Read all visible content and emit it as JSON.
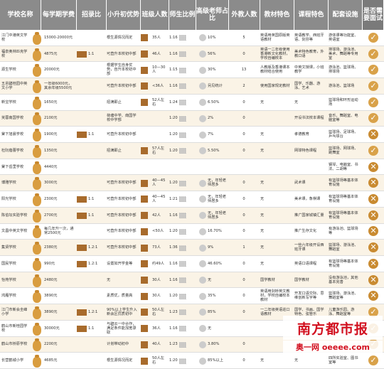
{
  "headers": [
    "学校名称",
    "每学期学费",
    "招录比",
    "小升初优势",
    "班级人数",
    "师生比例",
    "高级老师占比",
    "外教人数",
    "教材特色",
    "课程特色",
    "配套设施",
    "是否需要面试"
  ],
  "rows": [
    {
      "name": "江门中港英文学校",
      "fee": "15000-20000元",
      "ratio": "",
      "trans": "根生源情况而定",
      "class": "35人",
      "tr": "1:16",
      "senior": "10%",
      "foreign": "5",
      "books": "英语用英国原版英语教材",
      "course": "英语教学、西班牙语、剑芬等",
      "fac": "游体课等功能室、英语室",
      "intv": "yes"
    },
    {
      "name": "福泉奥林匹克学校",
      "fee": "4875元",
      "ratio": "1:1",
      "trans": "可直升本校初中部",
      "class": "46人",
      "tr": "1:16",
      "senior": "56%",
      "foreign": "0",
      "books": "英语一二年级使用香港新文化教材，学校自编校本",
      "course": "美术特色教育，外教口语",
      "fac": "排球场、游泳池、美术、舞蹈等专用室",
      "intv": "yes"
    },
    {
      "name": "源生学校",
      "fee": "20000元",
      "ratio": "",
      "trans": "根据学生自身优势，自升本校初中部",
      "class": "10—30人",
      "tr": "1:15",
      "senior": "30%",
      "foreign": "13",
      "books": "人教版及香港课本教材结合使用",
      "course": "中英文授课，小班教学",
      "fac": "游泳池、篮球场、排球场",
      "intv": "yes"
    },
    {
      "name": "五邑碧桂园中英文小学",
      "fee": "一年级6000元，其余年级5500元",
      "ratio": "",
      "trans": "可直升本校初中部",
      "class": "<36人",
      "tr": "1:16",
      "senior": "另见统计",
      "foreign": "2",
      "books": "使用国家规定教材",
      "course": "国学、乐器、游泳、艺术",
      "fac": "游泳池、篮球场",
      "intv": "yes"
    },
    {
      "name": "新宝学校",
      "fee": "1650元",
      "ratio": "",
      "trans": "招满即止",
      "class": "52人左右",
      "tr": "1:24",
      "senior": "6.50%",
      "foreign": "0",
      "books": "无",
      "course": "无",
      "fac": "篮球场和环形运动场",
      "intv": "yes"
    },
    {
      "name": "芙蓉南国学校",
      "fee": "2100元",
      "ratio": "",
      "trans": "荷塘中学、南国学校中学部",
      "class": "",
      "tr": "1:20",
      "senior": "2%",
      "foreign": "0",
      "books": "",
      "course": "开设书法校本课程",
      "fac": "音乐、舞蹈室、电脑室等",
      "intv": "yes"
    },
    {
      "name": "棠下旭晨学校",
      "fee": "1900元",
      "ratio": "1:1",
      "trans": "可直升本校初中部",
      "class": "",
      "tr": "1:20",
      "senior": "7%",
      "foreign": "0",
      "books": "无",
      "course": "孝德教育",
      "fac": "篮球场、足球场、乒乓球台",
      "intv": "no"
    },
    {
      "name": "杜阮蓓蕾学校",
      "fee": "1350元",
      "ratio": "",
      "trans": "招满即止",
      "class": "57人左右",
      "tr": "1:20",
      "senior": "5.50%",
      "foreign": "0",
      "books": "无",
      "course": "网球特色课程",
      "fac": "篮球场、网球场、跳舞室",
      "intv": "yes"
    },
    {
      "name": "棠下岳里学校",
      "fee": "4440元",
      "ratio": "",
      "trans": "",
      "class": "",
      "tr": "",
      "senior": "",
      "foreign": "",
      "books": "",
      "course": "",
      "fac": "钢琴、电脑室、书法、二胡等",
      "intv": "no"
    },
    {
      "name": "博雅学校",
      "fee": "3000元",
      "ratio": "",
      "trans": "可直升本校初中部",
      "class": "40—45人",
      "tr": "1:20",
      "senior": "无，年轻老师居多",
      "foreign": "0",
      "books": "无",
      "course": "武术课",
      "fac": "有篮球场等基本体育设施",
      "intv": "no"
    },
    {
      "name": "阳光学校",
      "fee": "2300元",
      "ratio": "1:1",
      "trans": "可直升本校初中部",
      "class": "40—45人",
      "tr": "1:21",
      "senior": "无，年轻老师居多",
      "foreign": "0",
      "books": "无",
      "course": "美术课，象棋课",
      "fac": "有篮球场等基本体育设施",
      "intv": "no"
    },
    {
      "name": "陈伯坛实验学校",
      "fee": "2700元",
      "ratio": "1:1",
      "trans": "可直升本校初中部",
      "class": "42人",
      "tr": "1:16",
      "senior": "无，年轻老师居多",
      "foreign": "0",
      "books": "无",
      "course": "推广国家城镇汇量",
      "fac": "有篮球场等基本体育设施",
      "intv": "no"
    },
    {
      "name": "文昌中英文学校",
      "fee": "每几年升一次，通常2500元",
      "ratio": "",
      "trans": "可直升本校初中部",
      "class": "<50人",
      "tr": "1:20",
      "senior": "16.70%",
      "foreign": "0",
      "books": "无",
      "course": "推广生存文化",
      "fac": "有游泳池、篮球场等",
      "intv": "no"
    },
    {
      "name": "集贤学校",
      "fee": "2380元",
      "ratio": "1.2:1",
      "trans": "可直升本校初中部",
      "class": "73人",
      "tr": "1:36",
      "senior": "9%",
      "foreign": "1",
      "books": "无",
      "course": "一些六年级开设西班牙课",
      "fac": "篮球场、游泳池、舞蹈室",
      "intv": "no"
    },
    {
      "name": "国民学校",
      "fee": "990元",
      "ratio": "1.2:1",
      "trans": "设置如开学金等",
      "class": "约49人",
      "tr": "1:16",
      "senior": "46.60%",
      "foreign": "0",
      "books": "无",
      "course": "英语口语课程",
      "fac": "有篮球场等基本体育设施",
      "intv": "no"
    },
    {
      "name": "怡苑学校",
      "fee": "2480元",
      "ratio": "",
      "trans": "无",
      "class": "30人",
      "tr": "1:16",
      "senior": "无",
      "foreign": "0",
      "books": "国学教材",
      "course": "国学教材",
      "fac": "没有游泳池，其他基本完善",
      "intv": "no"
    },
    {
      "name": "鸿雁学校",
      "fee": "3890元",
      "ratio": "",
      "trans": "素质优，质量高",
      "class": "30人",
      "tr": "1:20",
      "senior": "35%",
      "foreign": "0",
      "books": "英语用剑桥英文教材，学校自编校本教材",
      "course": "开发口语交际、思维创新写字等",
      "fac": "篮球场、游泳池、舞蹈室等",
      "intv": "no"
    },
    {
      "name": "江门市新会圭峰小学",
      "fee": "3890元",
      "ratio": "1.2:1",
      "trans": "90%以上学生升入新会区优质初中",
      "class": "50人左右",
      "tr": "1:23",
      "senior": "85%",
      "foreign": "0",
      "books": "一二年级英语进口语教材",
      "course": "国学、书画、国学特色、弦管乐",
      "fac": "儿童游乐园、游泳、舞蹈室等",
      "intv": "yes"
    },
    {
      "name": "鹤山市新桂园学校",
      "fee": "30000元",
      "ratio": "1:1",
      "trans": "与碧云一中合作，满足条件能加宽录取",
      "class": "36人",
      "tr": "1:16",
      "senior": "无",
      "foreign": "",
      "books": "",
      "course": "",
      "fac": "排球、游泳、羽毛球、舞室等",
      "intv": "yes"
    },
    {
      "name": "鹤山市桥原学校",
      "fee": "2200元",
      "ratio": "",
      "trans": "计划带动初中",
      "class": "40人",
      "tr": "1:23",
      "senior": "3.80%",
      "foreign": "0",
      "books": "",
      "course": "",
      "fac": "",
      "intv": "yes"
    },
    {
      "name": "长营鹤城小学",
      "fee": "4685元",
      "ratio": "",
      "trans": "根生源情况而定",
      "class": "50人左右",
      "tr": "1:20",
      "senior": "85%以上",
      "foreign": "0",
      "books": "无",
      "course": "无",
      "fac": "四所实验室、图书室等",
      "intv": "yes"
    }
  ],
  "watermark": "南方都市报",
  "site": "奥一网 oeeee.com",
  "colors": {
    "header": "#8b8b8b",
    "bar": "#a86b2c",
    "bag": "#d99d40",
    "mark": "#d9a24a",
    "brand": "#d2101f"
  }
}
